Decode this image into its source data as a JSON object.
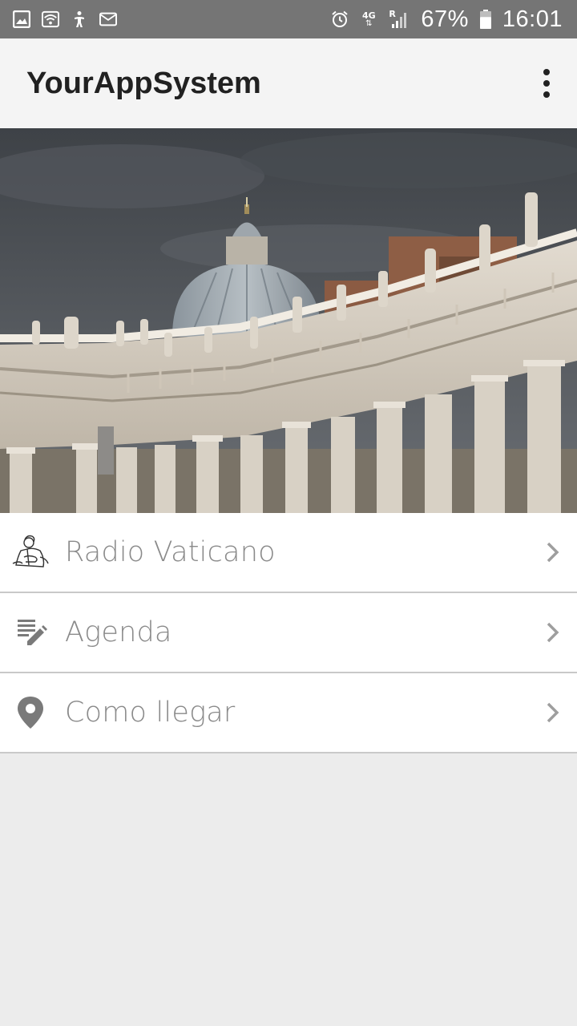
{
  "status_bar": {
    "icons_left": [
      "gallery-icon",
      "wifi-icon",
      "accessibility-icon",
      "email-icon"
    ],
    "icons_right": [
      "alarm-icon",
      "network-4g-icon",
      "signal-icon"
    ],
    "network_label": "4G",
    "roaming_label": "R",
    "battery_percent": "67%",
    "battery_level": 0.67,
    "time": "16:01"
  },
  "app_bar": {
    "title": "YourAppSystem",
    "overflow_icon": "more-vert-icon"
  },
  "hero": {
    "colors": {
      "sky": "#4f5358",
      "stone": "#d6cfc4",
      "shadow": "#a59d91"
    }
  },
  "menu": {
    "items": [
      {
        "label": "Radio Vaticano",
        "icon": "pope-sketch-icon"
      },
      {
        "label": "Agenda",
        "icon": "edit-notes-icon"
      },
      {
        "label": "Como llegar",
        "icon": "location-pin-icon"
      }
    ],
    "chevron_icon": "chevron-right-icon"
  },
  "colors": {
    "status_bar": "#757575",
    "app_bar": "#f4f4f4",
    "background": "#ececec",
    "menu_text": "#8a8a8a",
    "icon_gray": "#7a7a7a"
  }
}
